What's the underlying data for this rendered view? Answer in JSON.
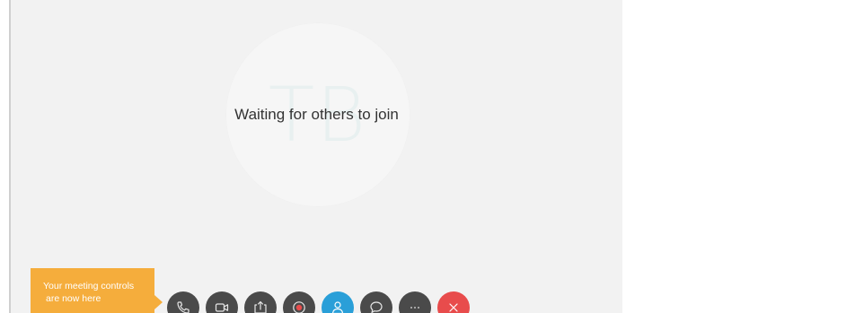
{
  "stage": {
    "avatar_initials": "TB",
    "waiting_message": "Waiting for others to join"
  },
  "tooltip": {
    "line1": "Your meeting controls",
    "line2": "are now here"
  },
  "colors": {
    "stage_background": "#f2f2f2",
    "tooltip_background": "#f5ad3c",
    "control_default": "#4a4a4a",
    "control_participants_active": "#2a9fd8",
    "control_end": "#e84c4c",
    "record_dot": "#e84c4c"
  },
  "controls": [
    {
      "name": "audio-button",
      "icon": "phone-icon"
    },
    {
      "name": "video-button",
      "icon": "video-camera-icon"
    },
    {
      "name": "share-button",
      "icon": "share-icon"
    },
    {
      "name": "record-button",
      "icon": "record-icon"
    },
    {
      "name": "participants-button",
      "icon": "person-icon",
      "active": true
    },
    {
      "name": "chat-button",
      "icon": "chat-bubble-icon"
    },
    {
      "name": "more-options-button",
      "icon": "more-icon"
    },
    {
      "name": "leave-meeting-button",
      "icon": "close-icon"
    }
  ]
}
